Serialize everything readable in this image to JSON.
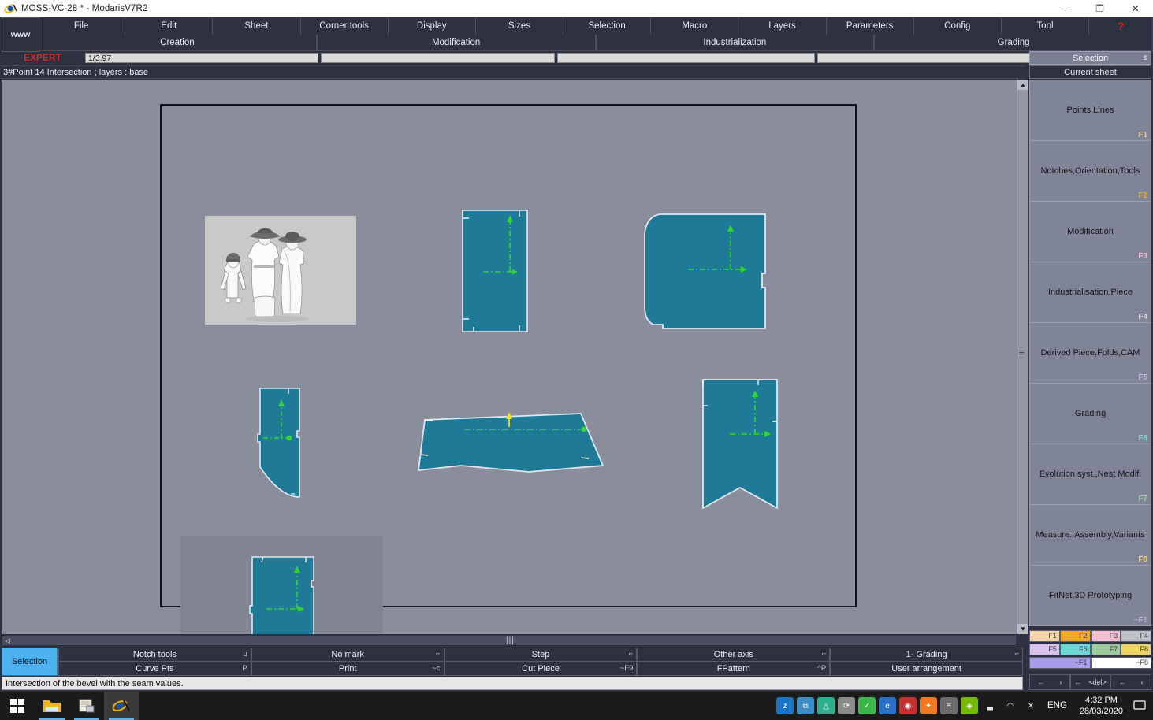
{
  "window": {
    "title": "MOSS-VC-28 *  - ModarisV7R2",
    "app_icon": "modaris-icon",
    "minimize_label": "─",
    "maximize_label": "❐",
    "close_label": "✕"
  },
  "menu": {
    "www_label": "www",
    "items": [
      {
        "label": "File"
      },
      {
        "label": "Edit"
      },
      {
        "label": "Sheet"
      },
      {
        "label": "Corner tools"
      },
      {
        "label": "Display"
      },
      {
        "label": "Sizes"
      },
      {
        "label": "Selection"
      },
      {
        "label": "Macro"
      },
      {
        "label": "Layers"
      },
      {
        "label": "Parameters"
      },
      {
        "label": "Config"
      },
      {
        "label": "Tool"
      }
    ],
    "help_label": "?"
  },
  "modes": [
    {
      "label": "Creation"
    },
    {
      "label": "Modification"
    },
    {
      "label": "Industrialization"
    },
    {
      "label": "Grading"
    }
  ],
  "expert_row": {
    "expert_label": "EXPERT",
    "field1_value": "1/3.97",
    "field2_value": "",
    "field3_value": "",
    "field4_value": ""
  },
  "selection_panel": {
    "header_label": "Selection",
    "header_hotkey": "s",
    "current_sheet_label": "Current sheet"
  },
  "info_line": {
    "text": "3#Point 14 Intersection ;    layers :  base"
  },
  "sidebar": {
    "items": [
      {
        "label": "Points,Lines",
        "key": "F1",
        "key_color": "#f2c27a"
      },
      {
        "label": "Notches,Orientation,Tools",
        "key": "F2",
        "key_color": "#f0a830"
      },
      {
        "label": "Modification",
        "key": "F3",
        "key_color": "#f5b8c8"
      },
      {
        "label": "Industrialisation,Piece",
        "key": "F4",
        "key_color": "#d6d9e0"
      },
      {
        "label": "Derived Piece,Folds,CAM",
        "key": "F5",
        "key_color": "#cdb8e8"
      },
      {
        "label": "Grading",
        "key": "F6",
        "key_color": "#7fd6d6"
      },
      {
        "label": "Evolution syst.,Nest Modif.",
        "key": "F7",
        "key_color": "#9ccf9c"
      },
      {
        "label": "Measure.,Assembly,Variants",
        "key": "F8",
        "key_color": "#ecd37a"
      },
      {
        "label": "FitNet,3D Prototyping",
        "key": "~F1",
        "key_color": "#b9b0e8"
      }
    ]
  },
  "grading_swatches": {
    "row1": [
      {
        "key": "F1",
        "color": "#f6d4a6"
      },
      {
        "key": "F2",
        "color": "#f0a830"
      },
      {
        "key": "F3",
        "color": "#f6bdcf"
      },
      {
        "key": "F4",
        "color": "#bdc0c6"
      }
    ],
    "row2": [
      {
        "key": "F5",
        "color": "#d8c2ec"
      },
      {
        "key": "F6",
        "color": "#6fd4d4"
      },
      {
        "key": "F7",
        "color": "#9cc89c"
      },
      {
        "key": "F8",
        "color": "#ecd267"
      }
    ],
    "row3": [
      {
        "key": "~F1",
        "color": "#a79ce8"
      },
      {
        "key": "~F8",
        "color": "#ffffff"
      }
    ],
    "arrows": [
      {
        "left": "←",
        "right": "›"
      },
      {
        "left": "←",
        "right": "<del>"
      },
      {
        "left": "←",
        "right": "‹"
      }
    ]
  },
  "function_bar": {
    "selection_button": "Selection",
    "row1": [
      {
        "label": "Notch tools",
        "hotkey": "u"
      },
      {
        "label": "No mark",
        "hotkey": "⌐"
      },
      {
        "label": "Step",
        "hotkey": "⌐"
      },
      {
        "label": "Other axis",
        "hotkey": "⌐"
      },
      {
        "label": "1- Grading",
        "hotkey": "⌐"
      }
    ],
    "row2": [
      {
        "label": "Curve Pts",
        "hotkey": "P"
      },
      {
        "label": "Print",
        "hotkey": "~c"
      },
      {
        "label": "Cut Piece",
        "hotkey": "~F9"
      },
      {
        "label": "FPattern",
        "hotkey": "^P"
      },
      {
        "label": "User arrangement",
        "hotkey": ""
      }
    ]
  },
  "message_line": {
    "text": "Intersection of the bevel with the seam values."
  },
  "canvas": {
    "piece_fill": "#1e7a96",
    "piece_stroke": "#dfe7ee",
    "axis_color": "#33d437",
    "axis_selected_color": "#e8e32a",
    "sheet_bg": "#8a8e9c",
    "gray_box_color": "#808490",
    "thumbnail_bg": "#c9c9c9",
    "thumbnail_name": "fashion-sketch-thumbnail",
    "pieces": [
      {
        "name": "rectangle-piece-top",
        "axis": "green"
      },
      {
        "name": "rounded-square-piece",
        "axis": "green"
      },
      {
        "name": "curved-side-piece",
        "axis": "green"
      },
      {
        "name": "wide-trapezoid-piece",
        "axis": "yellow"
      },
      {
        "name": "banner-notch-piece",
        "axis": "green"
      },
      {
        "name": "boxed-rectangle-piece",
        "axis": "green"
      }
    ]
  },
  "scrollbar": {
    "up_arrow": "▲",
    "down_arrow": "▼",
    "left_arrow": "◁",
    "grip": "|||"
  },
  "taskbar": {
    "start_icon": "windows-start-icon",
    "apps": [
      {
        "name": "file-explorer-icon"
      },
      {
        "name": "notepad-icon"
      },
      {
        "name": "modaris-icon"
      }
    ],
    "tray_icons": [
      {
        "name": "zoho-icon",
        "color": "#1a73c4",
        "glyph": "z"
      },
      {
        "name": "network-sync-icon",
        "color": "#3a8ec4",
        "glyph": "⧉"
      },
      {
        "name": "cloud-drive-icon",
        "color": "#2fae8e",
        "glyph": "△"
      },
      {
        "name": "refresh-icon",
        "color": "#8a8a8a",
        "glyph": "⟳"
      },
      {
        "name": "check-shield-icon",
        "color": "#3cb54a",
        "glyph": "✓"
      },
      {
        "name": "internet-explorer-icon",
        "color": "#2b6fc4",
        "glyph": "e"
      },
      {
        "name": "security-alert-icon",
        "color": "#c43030",
        "glyph": "◉"
      },
      {
        "name": "avast-icon",
        "color": "#f07820",
        "glyph": "✦"
      },
      {
        "name": "document-list-icon",
        "color": "#6a6a6a",
        "glyph": "≡"
      },
      {
        "name": "nvidia-icon",
        "color": "#76b900",
        "glyph": "◈"
      },
      {
        "name": "battery-icon",
        "color": "#d8d8d8",
        "glyph": "▃"
      },
      {
        "name": "wifi-icon",
        "color": "#d8d8d8",
        "glyph": "◠"
      },
      {
        "name": "volume-muted-icon",
        "color": "#d8d8d8",
        "glyph": "✕"
      }
    ],
    "language": "ENG",
    "time": "4:32 PM",
    "date": "28/03/2020",
    "notification_icon": "notification-icon"
  }
}
